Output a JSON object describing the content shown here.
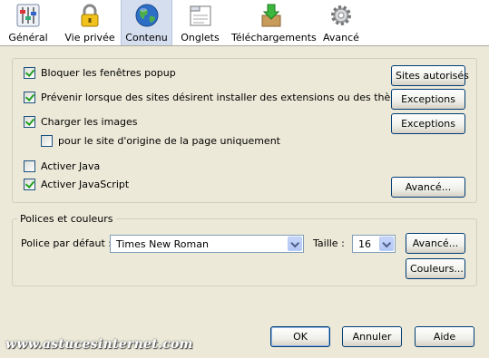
{
  "toolbar": {
    "items": [
      {
        "label": "Général",
        "icon": "sliders-icon"
      },
      {
        "label": "Vie privée",
        "icon": "padlock-icon"
      },
      {
        "label": "Contenu",
        "icon": "globe-icon"
      },
      {
        "label": "Onglets",
        "icon": "tabs-window-icon"
      },
      {
        "label": "Téléchargements",
        "icon": "download-box-icon"
      },
      {
        "label": "Avancé",
        "icon": "gear-icon"
      }
    ],
    "active": "Contenu"
  },
  "content": {
    "block_popups": {
      "label": "Bloquer les fenêtres popup",
      "checked": true
    },
    "warn_addons": {
      "label": "Prévenir lorsque des sites désirent installer des extensions ou des thèmes",
      "checked": true
    },
    "load_images": {
      "label": "Charger les images",
      "checked": true
    },
    "origin_only": {
      "label": "pour le site d'origine de la page uniquement",
      "checked": false
    },
    "enable_java": {
      "label": "Activer Java",
      "checked": false
    },
    "enable_js": {
      "label": "Activer JavaScript",
      "checked": true
    },
    "sites_button": "Sites autorisés",
    "exceptions_button_1": "Exceptions",
    "exceptions_button_2": "Exceptions",
    "advanced_button": "Avancé..."
  },
  "fonts": {
    "legend": "Polices et couleurs",
    "default_font_label": "Police par défaut :",
    "default_font_value": "Times New Roman",
    "size_label": "Taille :",
    "size_value": "16",
    "advanced_button": "Avancé...",
    "colors_button": "Couleurs..."
  },
  "footer": {
    "ok": "OK",
    "cancel": "Annuler",
    "help": "Aide"
  },
  "watermark": "www.astucesinternet.com",
  "colors": {
    "accent": "#003c74",
    "toolbar_active": "#d5deee",
    "dialog_bg": "#ece9d8"
  }
}
